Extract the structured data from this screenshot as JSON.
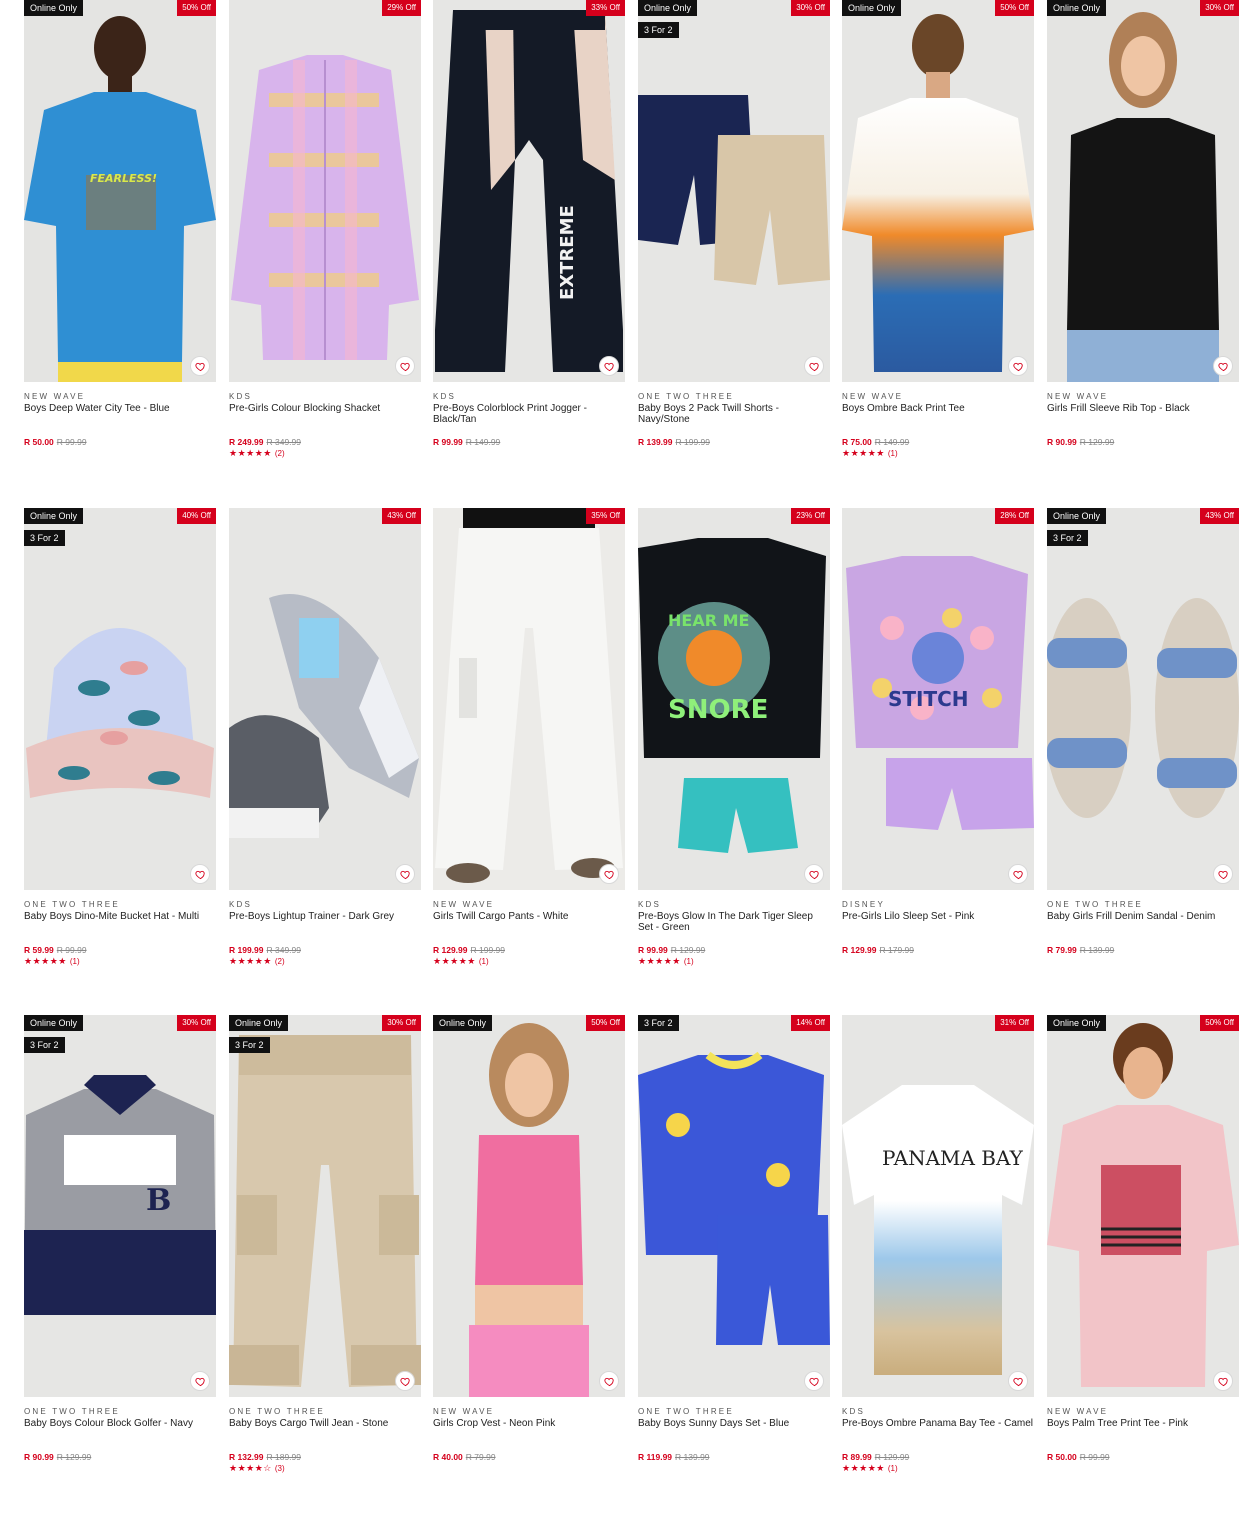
{
  "wishlist_icon": "heart-outline-icon",
  "star_icon": "star-icon",
  "colors": {
    "accent": "#d5001c",
    "badge_dark": "#111111",
    "tile_bg": "#e6e6e4"
  },
  "products": [
    {
      "badge_online": "Online Only",
      "badge_discount": "50% Off",
      "badge_promo": "",
      "brand": "NEW WAVE",
      "name": "Boys Deep Water City Tee - Blue",
      "price": "R 50.00",
      "was": "R 99.99",
      "stars": "",
      "rating_count": "",
      "art": "tee-blue"
    },
    {
      "badge_online": "",
      "badge_discount": "29% Off",
      "badge_promo": "",
      "brand": "KDS",
      "name": "Pre-Girls Colour Blocking Shacket",
      "price": "R 249.99",
      "was": "R 349.99",
      "stars": "★★★★★",
      "rating_count": "(2)",
      "art": "shacket"
    },
    {
      "badge_online": "",
      "badge_discount": "33% Off",
      "badge_promo": "",
      "brand": "KDS",
      "name": "Pre-Boys Colorblock Print Jogger - Black/Tan",
      "price": "R 99.99",
      "was": "R 149.99",
      "stars": "",
      "rating_count": "",
      "art": "jogger"
    },
    {
      "badge_online": "Online Only",
      "badge_discount": "30% Off",
      "badge_promo": "3 For 2",
      "brand": "ONE TWO THREE",
      "name": "Baby Boys 2 Pack Twill Shorts - Navy/Stone",
      "price": "R 139.99",
      "was": "R 199.99",
      "stars": "",
      "rating_count": "",
      "art": "shorts"
    },
    {
      "badge_online": "Online Only",
      "badge_discount": "50% Off",
      "badge_promo": "",
      "brand": "NEW WAVE",
      "name": "Boys Ombre Back Print Tee",
      "price": "R 75.00",
      "was": "R 149.99",
      "stars": "★★★★★",
      "rating_count": "(1)",
      "art": "tee-ombre"
    },
    {
      "badge_online": "Online Only",
      "badge_discount": "30% Off",
      "badge_promo": "",
      "brand": "NEW WAVE",
      "name": "Girls Frill Sleeve Rib Top - Black",
      "price": "R 90.99",
      "was": "R 129.99",
      "stars": "",
      "rating_count": "",
      "art": "top-black"
    },
    {
      "badge_online": "Online Only",
      "badge_discount": "40% Off",
      "badge_promo": "3 For 2",
      "brand": "ONE TWO THREE",
      "name": "Baby Boys Dino-Mite Bucket Hat - Multi",
      "price": "R 59.99",
      "was": "R 99.99",
      "stars": "★★★★★",
      "rating_count": "(1)",
      "art": "hat"
    },
    {
      "badge_online": "",
      "badge_discount": "43% Off",
      "badge_promo": "",
      "brand": "KDS",
      "name": "Pre-Boys Lightup Trainer - Dark Grey",
      "price": "R 199.99",
      "was": "R 349.99",
      "stars": "★★★★★",
      "rating_count": "(2)",
      "art": "trainer"
    },
    {
      "badge_online": "",
      "badge_discount": "35% Off",
      "badge_promo": "",
      "brand": "NEW WAVE",
      "name": "Girls Twill Cargo Pants - White",
      "price": "R 129.99",
      "was": "R 199.99",
      "stars": "★★★★★",
      "rating_count": "(1)",
      "art": "cargo-white"
    },
    {
      "badge_online": "",
      "badge_discount": "23% Off",
      "badge_promo": "",
      "brand": "KDS",
      "name": "Pre-Boys Glow In The Dark Tiger Sleep Set - Green",
      "price": "R 99.99",
      "was": "R 129.99",
      "stars": "★★★★★",
      "rating_count": "(1)",
      "art": "tiger-set"
    },
    {
      "badge_online": "",
      "badge_discount": "28% Off",
      "badge_promo": "",
      "brand": "DISNEY",
      "name": "Pre-Girls Lilo Sleep Set - Pink",
      "price": "R 129.99",
      "was": "R 179.99",
      "stars": "",
      "rating_count": "",
      "art": "lilo-set"
    },
    {
      "badge_online": "Online Only",
      "badge_discount": "43% Off",
      "badge_promo": "3 For 2",
      "brand": "ONE TWO THREE",
      "name": "Baby Girls Frill Denim Sandal - Denim",
      "price": "R 79.99",
      "was": "R 139.99",
      "stars": "",
      "rating_count": "",
      "art": "sandal"
    },
    {
      "badge_online": "Online Only",
      "badge_discount": "30% Off",
      "badge_promo": "3 For 2",
      "brand": "ONE TWO THREE",
      "name": "Baby Boys Colour Block Golfer - Navy",
      "price": "R 90.99",
      "was": "R 129.99",
      "stars": "",
      "rating_count": "",
      "art": "golfer"
    },
    {
      "badge_online": "Online Only",
      "badge_discount": "30% Off",
      "badge_promo": "3 For 2",
      "brand": "ONE TWO THREE",
      "name": "Baby Boys Cargo Twill Jean - Stone",
      "price": "R 132.99",
      "was": "R 189.99",
      "stars": "★★★★☆",
      "rating_count": "(3)",
      "art": "cargo-stone"
    },
    {
      "badge_online": "Online Only",
      "badge_discount": "50% Off",
      "badge_promo": "",
      "brand": "NEW WAVE",
      "name": "Girls Crop Vest - Neon Pink",
      "price": "R 40.00",
      "was": "R 79.99",
      "stars": "",
      "rating_count": "",
      "art": "vest-pink"
    },
    {
      "badge_online": "",
      "badge_discount": "14% Off",
      "badge_promo": "3 For 2",
      "brand": "ONE TWO THREE",
      "name": "Baby Boys Sunny Days Set - Blue",
      "price": "R 119.99",
      "was": "R 139.99",
      "stars": "",
      "rating_count": "",
      "art": "sunny-set"
    },
    {
      "badge_online": "",
      "badge_discount": "31% Off",
      "badge_promo": "",
      "brand": "KDS",
      "name": "Pre-Boys Ombre Panama Bay Tee - Camel",
      "price": "R 89.99",
      "was": "R 129.99",
      "stars": "★★★★★",
      "rating_count": "(1)",
      "art": "panama"
    },
    {
      "badge_online": "Online Only",
      "badge_discount": "50% Off",
      "badge_promo": "",
      "brand": "NEW WAVE",
      "name": "Boys Palm Tree Print Tee - Pink",
      "price": "R 50.00",
      "was": "R 99.99",
      "stars": "",
      "rating_count": "",
      "art": "tee-pink"
    }
  ],
  "art_text": {
    "fearless": "FEARLESS!",
    "panama": "PANAMA BAY",
    "extreme": "EXTREME",
    "snore": "SNORE",
    "hear_me": "HEAR ME",
    "stitch": "STITCH",
    "b_letter": "B"
  }
}
